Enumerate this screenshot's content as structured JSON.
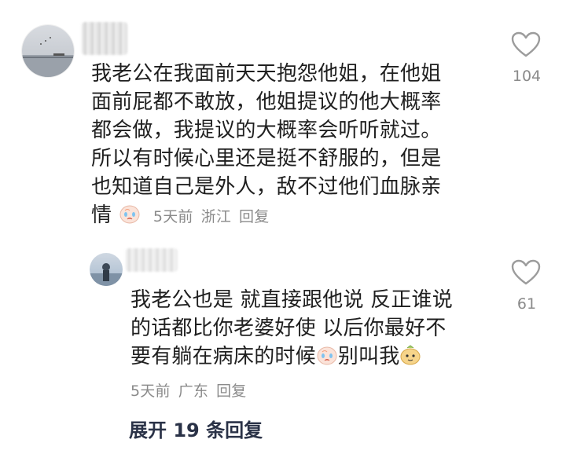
{
  "comment": {
    "lines": [
      "我老公在我面前天天抱怨他姐，在他姐",
      "面前屁都不敢放，他姐提议的他大概率",
      "都会做，我提议的大概率会听听就过。",
      "所以有时候心里还是挺不舒服的，但是",
      "也知道自己是外人，敌不过他们血脉亲",
      "情"
    ],
    "time": "5天前",
    "location": "浙江",
    "reply_label": "回复",
    "like_count": "104"
  },
  "reply": {
    "lines": [
      "我老公也是 就直接跟他说 反正谁说",
      "的话都比你老婆好使 以后你最好不",
      "要有躺在病床的时候",
      "别叫我"
    ],
    "time": "5天前",
    "location": "广东",
    "reply_label": "回复",
    "like_count": "61"
  },
  "expand_label": "展开 19 条回复",
  "icons": [
    "heart-outline-icon",
    "crying-emoji-icon",
    "smug-emoji-icon"
  ],
  "colors": {
    "text": "#1f1f1f",
    "meta": "#8a8a8a",
    "expand": "#2a3247"
  }
}
